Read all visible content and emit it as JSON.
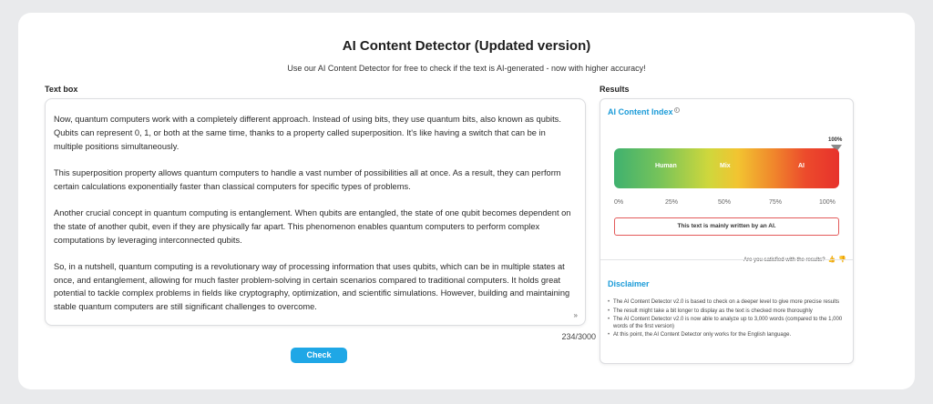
{
  "header": {
    "title": "AI Content Detector (Updated version)",
    "subtitle": "Use our AI Content Detector for free to check if the text is AI-generated - now with higher accuracy!"
  },
  "textbox": {
    "label": "Text box",
    "paragraphs": [
      "Now, quantum computers work with a completely different approach. Instead of using bits, they use quantum bits, also known as qubits. Qubits can represent 0, 1, or both at the same time, thanks to a property called superposition. It's like having a switch that can be in multiple positions simultaneously.",
      "This superposition property allows quantum computers to handle a vast number of possibilities all at once. As a result, they can perform certain calculations exponentially faster than classical computers for specific types of problems.",
      "Another crucial concept in quantum computing is entanglement. When qubits are entangled, the state of one qubit becomes dependent on the state of another qubit, even if they are physically far apart. This phenomenon enables quantum computers to perform complex computations by leveraging interconnected qubits.",
      "So, in a nutshell, quantum computing is a revolutionary way of processing information that uses qubits, which can be in multiple states at once, and entanglement, allowing for much faster problem-solving in certain scenarios compared to traditional computers. It holds great potential to tackle complex problems in fields like cryptography, optimization, and scientific simulations. However, building and maintaining stable quantum computers are still significant challenges to overcome."
    ],
    "counter": "234/3000",
    "resize_glyph": "»"
  },
  "actions": {
    "check_label": "Check"
  },
  "results": {
    "label": "Results",
    "index_heading": "AI Content Index",
    "info_glyph": "i",
    "gauge": {
      "value_percent": 100,
      "value_label": "100%",
      "zones": [
        "Human",
        "Mix",
        "AI"
      ],
      "ticks": [
        "0%",
        "25%",
        "50%",
        "75%",
        "100%"
      ]
    },
    "verdict": "This text is mainly written by an AI.",
    "satisfied_text": "Are you satisfied with the results?",
    "thumb_up": "👍",
    "thumb_down": "👎",
    "disclaimer_heading": "Disclaimer",
    "disclaimer_items": [
      "The AI Content Detector v2.0 is based to check on a deeper level to give more precise results",
      "The result might take a bit longer to display as the text is checked more thoroughly",
      "The AI Content Detector v2.0 is now able to analyze up to 3,000 words (compared to the 1,000 words of the first version)",
      "At this point, the AI Content Detector only works for the English language."
    ]
  },
  "colors": {
    "accent": "#1b9bd8",
    "button": "#1fa7e6",
    "verdict_border": "#e35a5a",
    "gauge_start": "#3fb16f",
    "gauge_end": "#e7322c"
  }
}
